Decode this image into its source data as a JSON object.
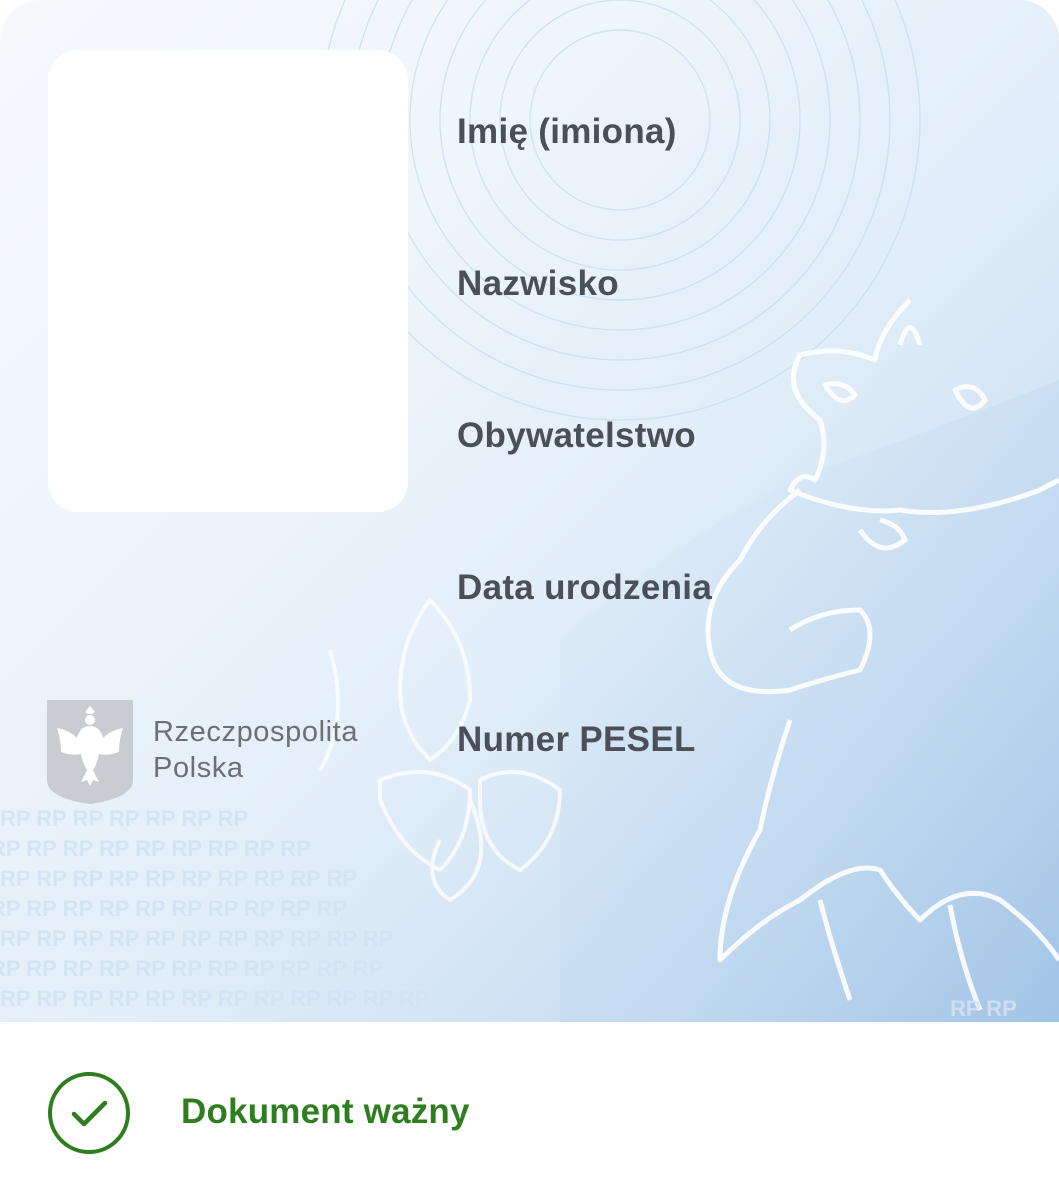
{
  "document": {
    "fields": [
      {
        "label": "Imię (imiona)"
      },
      {
        "label": "Nazwisko"
      },
      {
        "label": "Obywatelstwo"
      },
      {
        "label": "Data urodzenia"
      },
      {
        "label": "Numer PESEL"
      }
    ],
    "country": {
      "line1": "Rzeczpospolita",
      "line2": "Polska"
    },
    "watermark_text": "RP"
  },
  "status": {
    "label": "Dokument ważny",
    "icon": "checkmark-circle-icon",
    "color": "#2e7d1f"
  }
}
